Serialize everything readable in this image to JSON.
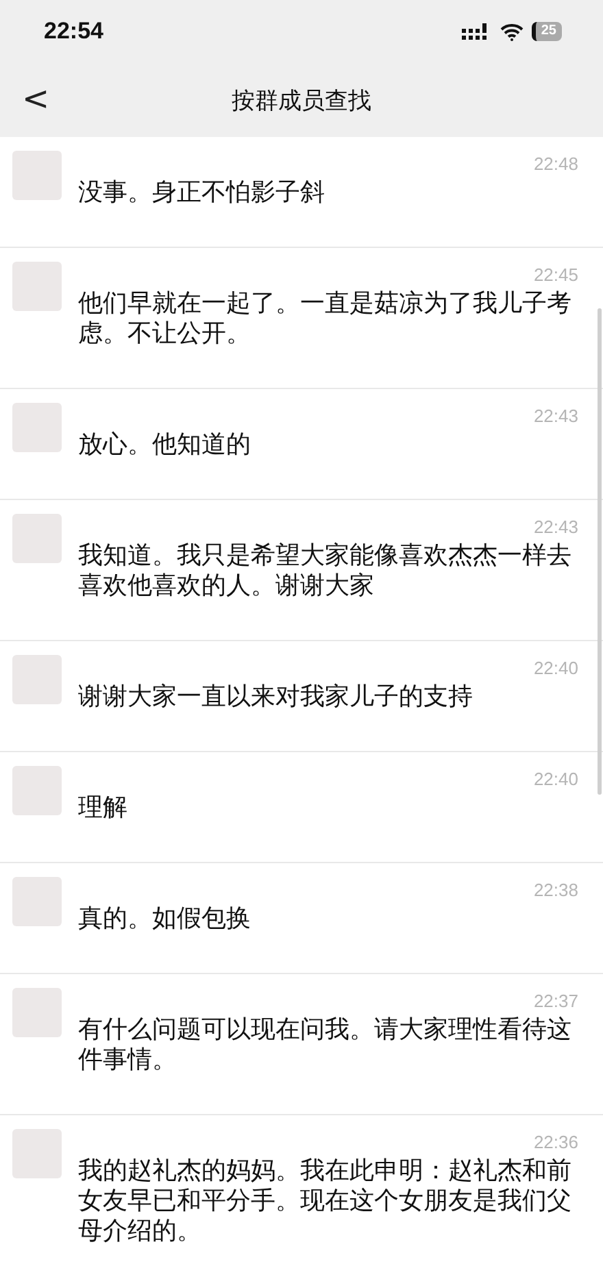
{
  "status_bar": {
    "time": "22:54",
    "battery": "25"
  },
  "nav_bar": {
    "back": "<",
    "title": "按群成员查找"
  },
  "messages": [
    {
      "time": "22:48",
      "text": "没事。身正不怕影子斜"
    },
    {
      "time": "22:45",
      "text": "他们早就在一起了。一直是菇凉为了我儿子考虑。不让公开。"
    },
    {
      "time": "22:43",
      "text": "放心。他知道的"
    },
    {
      "time": "22:43",
      "text": "我知道。我只是希望大家能像喜欢杰杰一样去喜欢他喜欢的人。谢谢大家"
    },
    {
      "time": "22:40",
      "text": "谢谢大家一直以来对我家儿子的支持"
    },
    {
      "time": "22:40",
      "text": "理解"
    },
    {
      "time": "22:38",
      "text": "真的。如假包换"
    },
    {
      "time": "22:37",
      "text": "有什么问题可以现在问我。请大家理性看待这件事情。"
    },
    {
      "time": "22:36",
      "text": "我的赵礼杰的妈妈。我在此申明：赵礼杰和前女友早已和平分手。现在这个女朋友是我们父母介绍的。"
    }
  ]
}
